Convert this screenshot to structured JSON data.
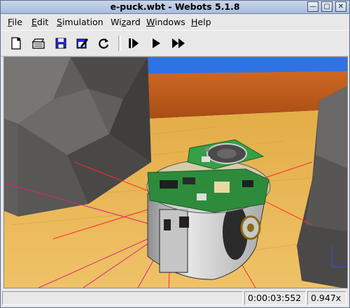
{
  "window": {
    "title": "e-puck.wbt - Webots 5.1.8"
  },
  "titlebar_buttons": [
    "—",
    "▢",
    "✕"
  ],
  "menu": [
    {
      "label_pre": "",
      "accel": "F",
      "label_post": "ile"
    },
    {
      "label_pre": "",
      "accel": "E",
      "label_post": "dit"
    },
    {
      "label_pre": "",
      "accel": "S",
      "label_post": "imulation"
    },
    {
      "label_pre": "Wi",
      "accel": "z",
      "label_post": "ard"
    },
    {
      "label_pre": "",
      "accel": "W",
      "label_post": "indows"
    },
    {
      "label_pre": "",
      "accel": "H",
      "label_post": "elp"
    }
  ],
  "toolbar": {
    "icons": [
      "new-world-icon",
      "open-icon",
      "save-icon",
      "edit-icon",
      "revert-icon",
      "step-icon",
      "run-icon",
      "fast-run-icon"
    ]
  },
  "scene": {
    "colors": {
      "sky": "#2b6ee0",
      "wall": "#c05a1c",
      "floor": "#e9b54e",
      "rock": "#5c5c5c",
      "robot_body": "#d9d9d9",
      "pcb": "#2e8b3c",
      "ray": "#e0207a"
    }
  },
  "status": {
    "message": "",
    "time": "0:00:03:552",
    "speed": "0.947x"
  }
}
